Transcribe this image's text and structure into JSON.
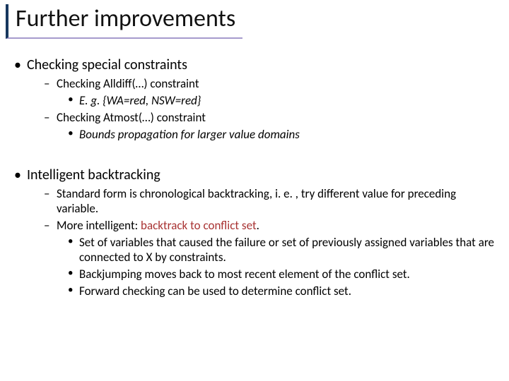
{
  "title": "Further improvements",
  "section1": {
    "heading": "Checking special constraints",
    "items": {
      "alldiff": "Checking Alldiff(…) constraint",
      "alldiff_eg": "E. g. {WA=red, NSW=red}",
      "atmost": "Checking Atmost(…) constraint",
      "atmost_eg": "Bounds propagation for larger value domains"
    }
  },
  "section2": {
    "heading": "Intelligent backtracking",
    "items": {
      "standard": "Standard form is chronological backtracking, i. e. , try different value for preceding variable.",
      "more_pre": "More intelligent: ",
      "more_hl": "backtrack to conflict set",
      "more_post": ".",
      "set_desc": "Set of variables that caused the failure or set of previously assigned variables that are connected to X by constraints.",
      "backjump": "Backjumping moves back to most recent element of the conflict set.",
      "forward": "Forward checking can be used to determine conflict set."
    }
  }
}
